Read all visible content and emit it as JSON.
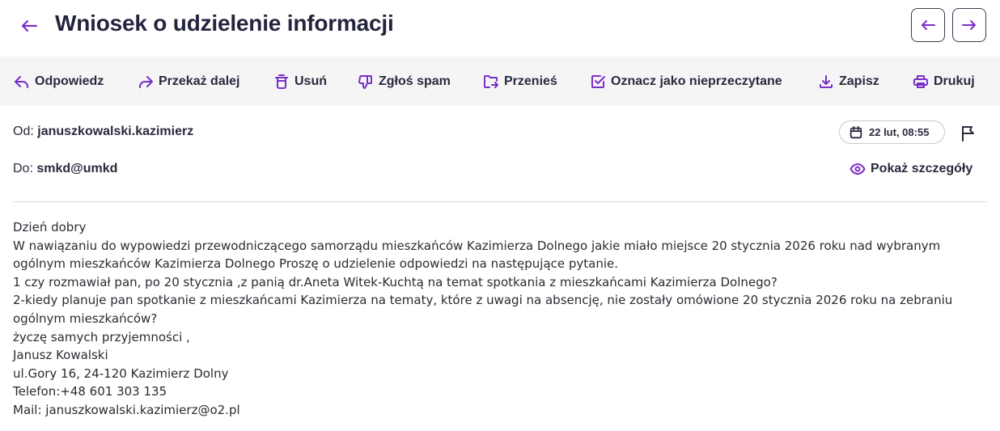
{
  "header": {
    "title": "Wniosek o udzielenie informacji"
  },
  "toolbar": {
    "reply": "Odpowiedz",
    "forward": "Przekaż dalej",
    "delete": "Usuń",
    "spam": "Zgłoś spam",
    "move": "Przenieś",
    "mark_unread": "Oznacz jako nieprzeczytane",
    "save": "Zapisz",
    "print": "Drukuj"
  },
  "message": {
    "from_label": "Od:",
    "from": "januszkowalski.kazimierz",
    "to_label": "Do:",
    "to": "smkd@umkd",
    "date": "22 lut, 08:55",
    "details_label": "Pokaż szczegóły",
    "body_lines": [
      "Dzień dobry",
      "W nawiązaniu do wypowiedzi przewodniczącego samorządu mieszkańców Kazimierza Dolnego jakie miało miejsce 20 stycznia 2026 roku nad wybranym",
      "ogólnym mieszkańców Kazimierza Dolnego Proszę o udzielenie odpowiedzi na następujące pytanie.",
      "1 czy rozmawiał pan, po 20 stycznia ,z panią dr.Aneta Witek-Kuchtą na temat spotkania z mieszkańcami Kazimierza Dolnego?",
      "2-kiedy planuje pan spotkanie z mieszkańcami Kazimierza na tematy, które z uwagi na absencję, nie zostały omówione 20 stycznia 2026 roku na zebraniu",
      "ogólnym mieszkańców?",
      "życzę samych przyjemności ,",
      "Janusz Kowalski",
      "ul.Gory 16, 24-120 Kazimierz Dolny",
      "Telefon:+48 601 303 135",
      "Mail: januszkowalski.kazimierz@o2.pl"
    ]
  },
  "colors": {
    "accent": "#7a2fc9",
    "text": "#2a2a3e",
    "toolbar_bg": "#f5f5f6"
  }
}
